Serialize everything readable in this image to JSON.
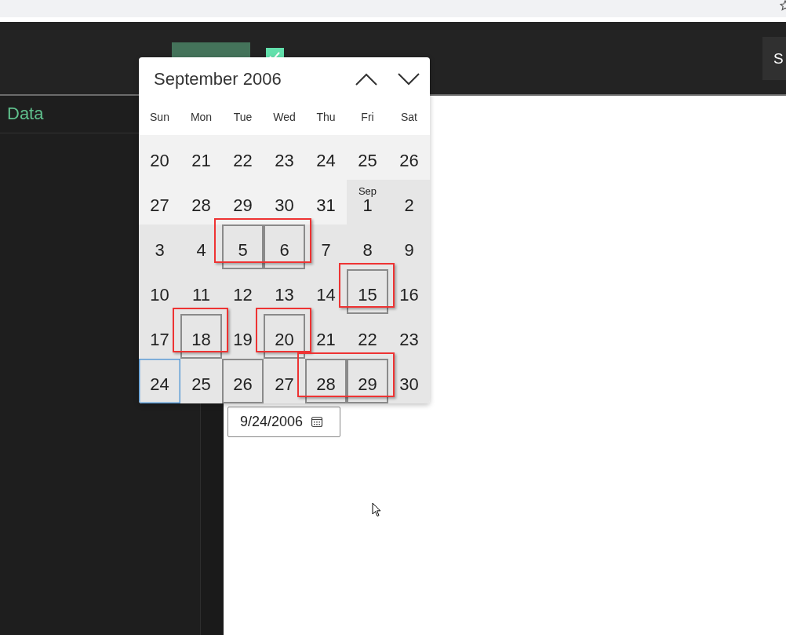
{
  "toolbar": {
    "autorun": {
      "checked": true
    },
    "right_button": "S"
  },
  "sidebar": {
    "title": "Data"
  },
  "calendar": {
    "title": "September 2006",
    "weekdays": [
      "Sun",
      "Mon",
      "Tue",
      "Wed",
      "Thu",
      "Fri",
      "Sat"
    ],
    "days": [
      {
        "text": "20",
        "in_month": false,
        "outlined": false,
        "selected": false,
        "annotated": false
      },
      {
        "text": "21",
        "in_month": false,
        "outlined": false,
        "selected": false,
        "annotated": false
      },
      {
        "text": "22",
        "in_month": false,
        "outlined": false,
        "selected": false,
        "annotated": false
      },
      {
        "text": "23",
        "in_month": false,
        "outlined": false,
        "selected": false,
        "annotated": false
      },
      {
        "text": "24",
        "in_month": false,
        "outlined": false,
        "selected": false,
        "annotated": false
      },
      {
        "text": "25",
        "in_month": false,
        "outlined": false,
        "selected": false,
        "annotated": false
      },
      {
        "text": "26",
        "in_month": false,
        "outlined": false,
        "selected": false,
        "annotated": false
      },
      {
        "text": "27",
        "in_month": false,
        "outlined": false,
        "selected": false,
        "annotated": false
      },
      {
        "text": "28",
        "in_month": false,
        "outlined": false,
        "selected": false,
        "annotated": false
      },
      {
        "text": "29",
        "in_month": false,
        "outlined": false,
        "selected": false,
        "annotated": false
      },
      {
        "text": "30",
        "in_month": false,
        "outlined": false,
        "selected": false,
        "annotated": false
      },
      {
        "text": "31",
        "in_month": false,
        "outlined": false,
        "selected": false,
        "annotated": false
      },
      {
        "text": "1",
        "month_label": "Sep",
        "in_month": true,
        "outlined": false,
        "selected": false,
        "annotated": false
      },
      {
        "text": "2",
        "in_month": true,
        "outlined": false,
        "selected": false,
        "annotated": false
      },
      {
        "text": "3",
        "in_month": true,
        "outlined": false,
        "selected": false,
        "annotated": false
      },
      {
        "text": "4",
        "in_month": true,
        "outlined": false,
        "selected": false,
        "annotated": false
      },
      {
        "text": "5",
        "in_month": true,
        "outlined": true,
        "selected": false,
        "annotated": true
      },
      {
        "text": "6",
        "in_month": true,
        "outlined": true,
        "selected": false,
        "annotated": true
      },
      {
        "text": "7",
        "in_month": true,
        "outlined": false,
        "selected": false,
        "annotated": false
      },
      {
        "text": "8",
        "in_month": true,
        "outlined": false,
        "selected": false,
        "annotated": false
      },
      {
        "text": "9",
        "in_month": true,
        "outlined": false,
        "selected": false,
        "annotated": false
      },
      {
        "text": "10",
        "in_month": true,
        "outlined": false,
        "selected": false,
        "annotated": false
      },
      {
        "text": "11",
        "in_month": true,
        "outlined": false,
        "selected": false,
        "annotated": false
      },
      {
        "text": "12",
        "in_month": true,
        "outlined": false,
        "selected": false,
        "annotated": false
      },
      {
        "text": "13",
        "in_month": true,
        "outlined": false,
        "selected": false,
        "annotated": false
      },
      {
        "text": "14",
        "in_month": true,
        "outlined": false,
        "selected": false,
        "annotated": false
      },
      {
        "text": "15",
        "in_month": true,
        "outlined": true,
        "selected": false,
        "annotated": true
      },
      {
        "text": "16",
        "in_month": true,
        "outlined": false,
        "selected": false,
        "annotated": false
      },
      {
        "text": "17",
        "in_month": true,
        "outlined": false,
        "selected": false,
        "annotated": false
      },
      {
        "text": "18",
        "in_month": true,
        "outlined": true,
        "selected": false,
        "annotated": true
      },
      {
        "text": "19",
        "in_month": true,
        "outlined": false,
        "selected": false,
        "annotated": false
      },
      {
        "text": "20",
        "in_month": true,
        "outlined": true,
        "selected": false,
        "annotated": true
      },
      {
        "text": "21",
        "in_month": true,
        "outlined": false,
        "selected": false,
        "annotated": false
      },
      {
        "text": "22",
        "in_month": true,
        "outlined": false,
        "selected": false,
        "annotated": false
      },
      {
        "text": "23",
        "in_month": true,
        "outlined": false,
        "selected": false,
        "annotated": false
      },
      {
        "text": "24",
        "in_month": true,
        "outlined": false,
        "selected": true,
        "annotated": false
      },
      {
        "text": "25",
        "in_month": true,
        "outlined": false,
        "selected": false,
        "annotated": false
      },
      {
        "text": "26",
        "in_month": true,
        "outlined": true,
        "selected": false,
        "annotated": false
      },
      {
        "text": "27",
        "in_month": true,
        "outlined": false,
        "selected": false,
        "annotated": false
      },
      {
        "text": "28",
        "in_month": true,
        "outlined": true,
        "selected": false,
        "annotated": true
      },
      {
        "text": "29",
        "in_month": true,
        "outlined": true,
        "selected": false,
        "annotated": true
      },
      {
        "text": "30",
        "in_month": true,
        "outlined": false,
        "selected": false,
        "annotated": false
      }
    ]
  },
  "date_field": {
    "value": "9/24/2006"
  }
}
